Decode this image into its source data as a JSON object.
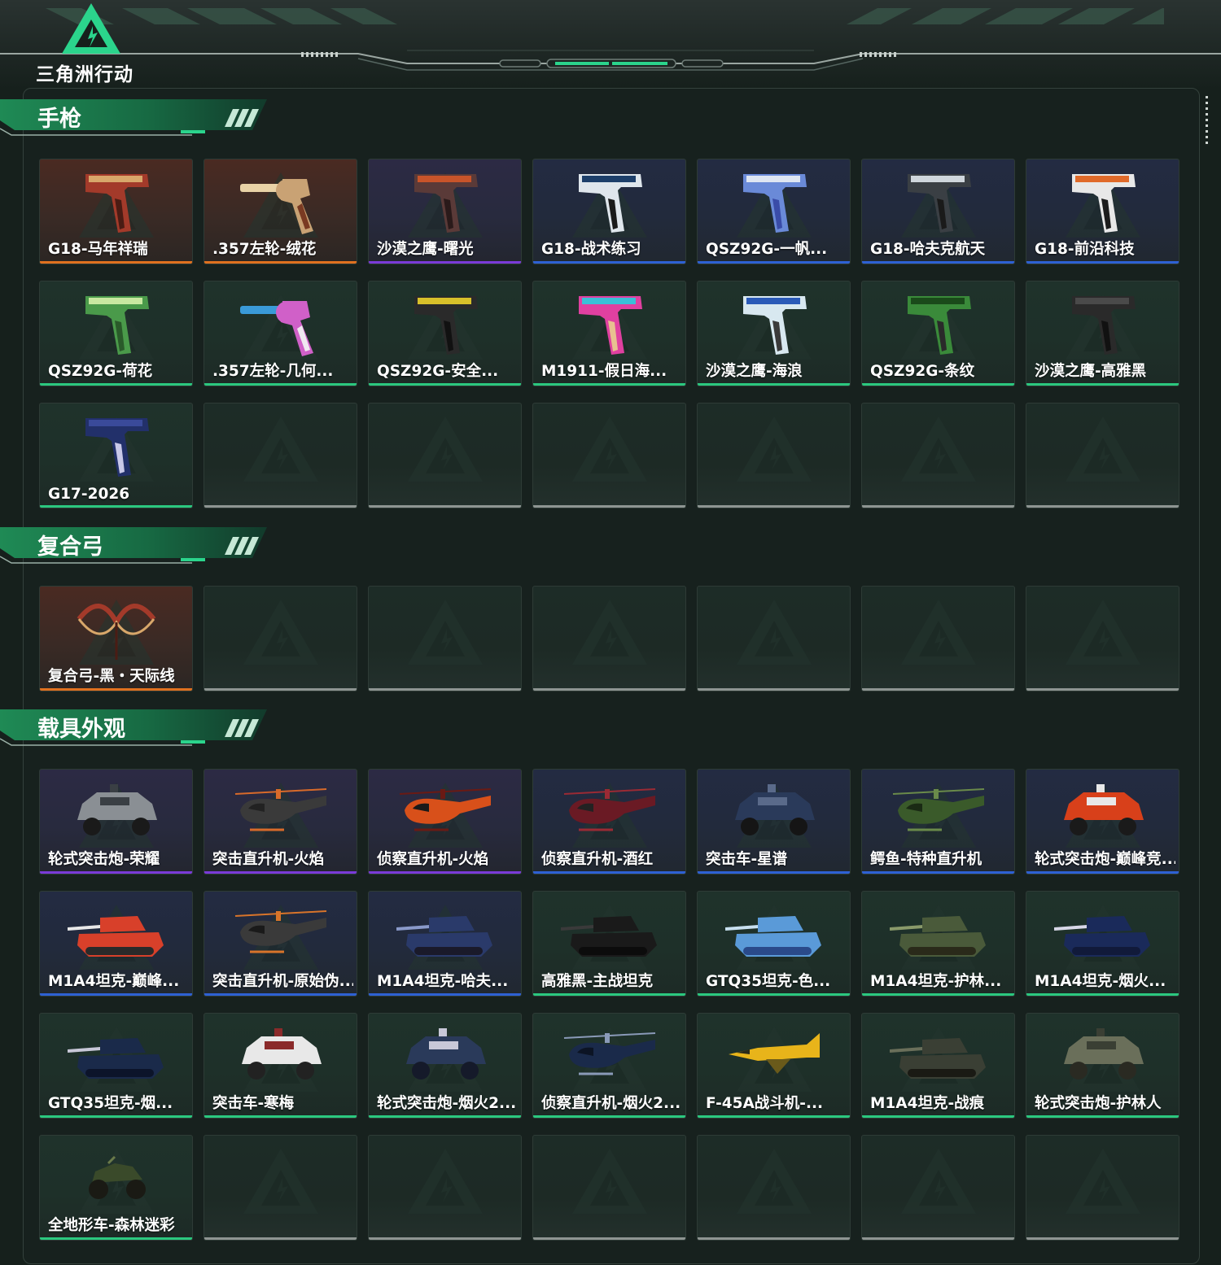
{
  "app": {
    "logo_text": "三角洲行动",
    "accent_color": "#2bd48c"
  },
  "sections": [
    {
      "title": "手枪",
      "items": [
        {
          "label": "G18-马年祥瑞",
          "rarity": "orange",
          "icon": "pistol-icon"
        },
        {
          "label": ".357左轮-绒花",
          "rarity": "orange",
          "icon": "revolver-icon"
        },
        {
          "label": "沙漠之鹰-曙光",
          "rarity": "purple",
          "icon": "pistol-icon"
        },
        {
          "label": "G18-战术练习",
          "rarity": "blue",
          "icon": "pistol-icon"
        },
        {
          "label": "QSZ92G-一帆...",
          "rarity": "blue",
          "icon": "pistol-icon"
        },
        {
          "label": "G18-哈夫克航天",
          "rarity": "blue",
          "icon": "pistol-icon"
        },
        {
          "label": "G18-前沿科技",
          "rarity": "blue",
          "icon": "pistol-icon"
        },
        {
          "label": "QSZ92G-荷花",
          "rarity": "green",
          "icon": "pistol-icon"
        },
        {
          "label": ".357左轮-几何...",
          "rarity": "green",
          "icon": "revolver-icon"
        },
        {
          "label": "QSZ92G-安全...",
          "rarity": "green",
          "icon": "pistol-icon"
        },
        {
          "label": "M1911-假日海...",
          "rarity": "green",
          "icon": "pistol-icon"
        },
        {
          "label": "沙漠之鹰-海浪",
          "rarity": "green",
          "icon": "pistol-icon"
        },
        {
          "label": "QSZ92G-条纹",
          "rarity": "green",
          "icon": "pistol-icon"
        },
        {
          "label": "沙漠之鹰-高雅黑",
          "rarity": "green",
          "icon": "pistol-icon"
        },
        {
          "label": "G17-2026",
          "rarity": "green",
          "icon": "pistol-icon"
        }
      ]
    },
    {
      "title": "复合弓",
      "items": [
        {
          "label": "复合弓-黑・天际线",
          "rarity": "orange",
          "icon": "bow-icon"
        }
      ]
    },
    {
      "title": "载具外观",
      "items": [
        {
          "label": "轮式突击炮-荣耀",
          "rarity": "purple",
          "icon": "armored-car-icon"
        },
        {
          "label": "突击直升机-火焰",
          "rarity": "purple",
          "icon": "helicopter-icon"
        },
        {
          "label": "侦察直升机-火焰",
          "rarity": "purple",
          "icon": "helicopter-icon"
        },
        {
          "label": "侦察直升机-酒红",
          "rarity": "blue",
          "icon": "helicopter-icon"
        },
        {
          "label": "突击车-星谱",
          "rarity": "blue",
          "icon": "armored-car-icon"
        },
        {
          "label": "鳄鱼-特种直升机",
          "rarity": "blue",
          "icon": "helicopter-icon"
        },
        {
          "label": "轮式突击炮-巅峰竞...",
          "rarity": "blue",
          "icon": "armored-car-icon"
        },
        {
          "label": "M1A4坦克-巅峰...",
          "rarity": "blue",
          "icon": "tank-icon"
        },
        {
          "label": "突击直升机-原始伪...",
          "rarity": "blue",
          "icon": "helicopter-icon"
        },
        {
          "label": "M1A4坦克-哈夫...",
          "rarity": "blue",
          "icon": "tank-icon"
        },
        {
          "label": "高雅黑-主战坦克",
          "rarity": "green",
          "icon": "tank-icon"
        },
        {
          "label": "GTQ35坦克-色...",
          "rarity": "green",
          "icon": "tank-icon"
        },
        {
          "label": "M1A4坦克-护林...",
          "rarity": "green",
          "icon": "tank-icon"
        },
        {
          "label": "M1A4坦克-烟火...",
          "rarity": "green",
          "icon": "tank-icon"
        },
        {
          "label": "GTQ35坦克-烟...",
          "rarity": "green",
          "icon": "tank-icon"
        },
        {
          "label": "突击车-寒梅",
          "rarity": "green",
          "icon": "armored-car-icon"
        },
        {
          "label": "轮式突击炮-烟火2...",
          "rarity": "green",
          "icon": "armored-car-icon"
        },
        {
          "label": "侦察直升机-烟火2...",
          "rarity": "green",
          "icon": "helicopter-icon"
        },
        {
          "label": "F-45A战斗机-...",
          "rarity": "green",
          "icon": "jet-icon"
        },
        {
          "label": "M1A4坦克-战痕",
          "rarity": "green",
          "icon": "tank-icon"
        },
        {
          "label": "轮式突击炮-护林人",
          "rarity": "green",
          "icon": "armored-car-icon"
        },
        {
          "label": "全地形车-森林迷彩",
          "rarity": "green",
          "icon": "atv-icon"
        }
      ]
    }
  ]
}
